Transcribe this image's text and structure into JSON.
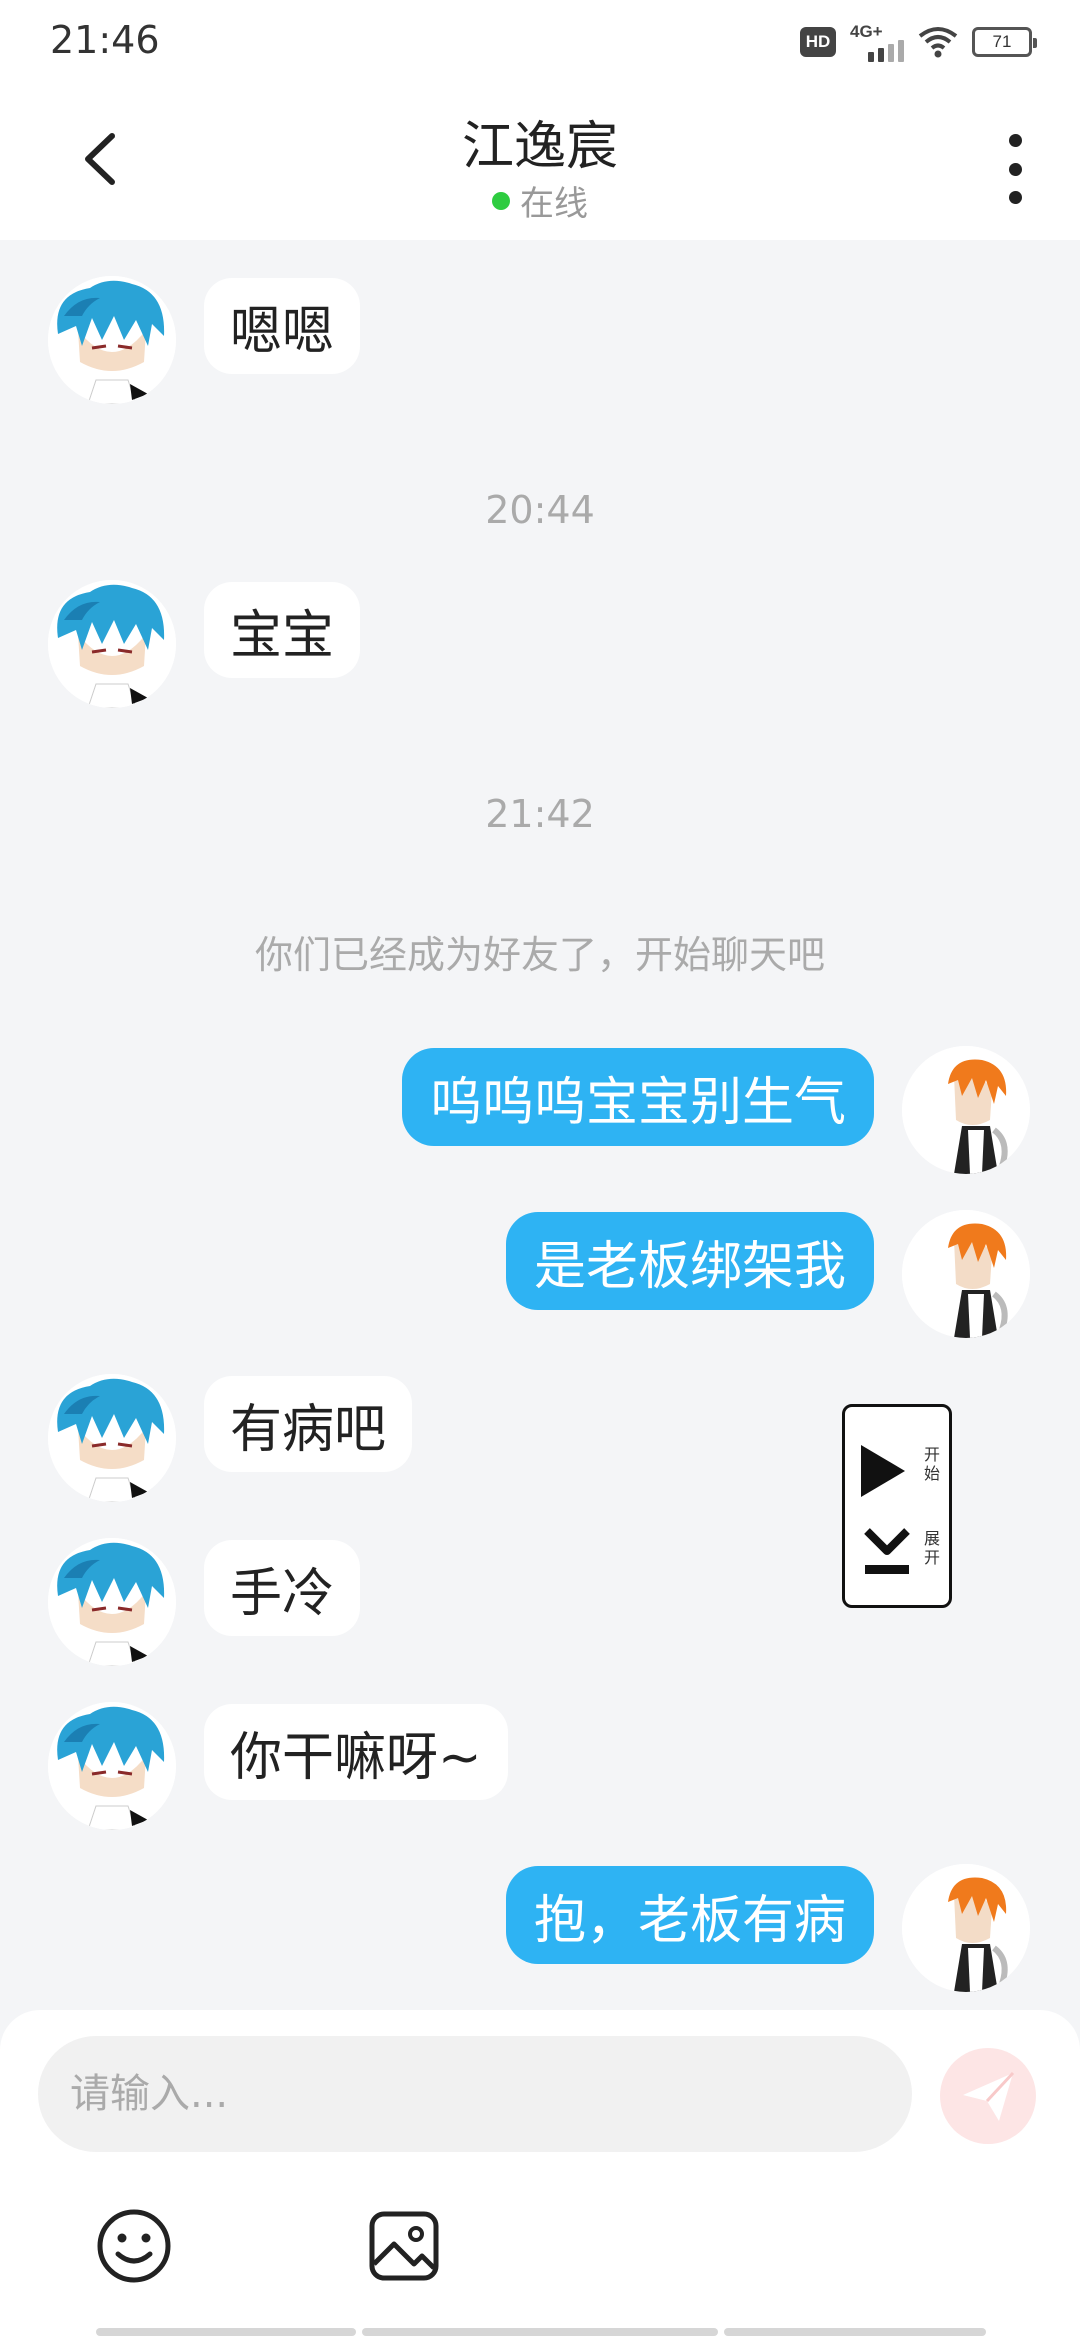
{
  "status_bar": {
    "time": "21:46",
    "hd_badge": "HD",
    "network": "4G+",
    "battery": "71"
  },
  "header": {
    "title": "江逸宸",
    "status": "在线"
  },
  "messages": [
    {
      "side": "left",
      "text": "嗯嗯"
    },
    {
      "timestamp": "20:44"
    },
    {
      "side": "left",
      "text": "宝宝"
    },
    {
      "timestamp": "21:42"
    },
    {
      "system": "你们已经成为好友了，开始聊天吧"
    },
    {
      "side": "right",
      "text": "呜呜呜宝宝别生气"
    },
    {
      "side": "right",
      "text": "是老板绑架我"
    },
    {
      "side": "left",
      "text": "有病吧"
    },
    {
      "side": "left",
      "text": "手冷"
    },
    {
      "side": "left",
      "text": "你干嘛呀~"
    },
    {
      "side": "right",
      "text": "抱，老板有病"
    }
  ],
  "floating_widget": {
    "start_label": "开始",
    "expand_label": "展开"
  },
  "input": {
    "placeholder": "请输入..."
  },
  "toolbar": {
    "emoji_icon": "emoji-icon",
    "image_icon": "image-icon"
  },
  "colors": {
    "my_bubble": "#2eb3f3",
    "background": "#f4f5f7",
    "online_dot": "#2ecc40",
    "send_button": "#fde5e5"
  }
}
